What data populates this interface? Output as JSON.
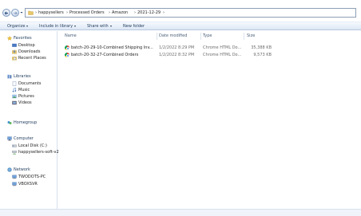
{
  "address": {
    "crumbs": [
      "happysellers",
      "Processed Orders",
      "Amazon",
      "2021-12-29"
    ]
  },
  "toolbar": {
    "organize": "Organize",
    "include_in_library": "Include in library",
    "share_with": "Share with",
    "new_folder": "New folder"
  },
  "navpane": {
    "favorites": {
      "title": "Favorites",
      "items": [
        "Desktop",
        "Downloads",
        "Recent Places"
      ]
    },
    "libraries": {
      "title": "Libraries",
      "items": [
        "Documents",
        "Music",
        "Pictures",
        "Videos"
      ]
    },
    "homegroup": "Homegroup",
    "computer": {
      "title": "Computer",
      "items": [
        "Local Disk (C:)",
        "happysellers-soft-v2"
      ]
    },
    "network": {
      "title": "Network",
      "items": [
        "TWODOTS-PC",
        "VBOXSVR"
      ]
    }
  },
  "columns": {
    "name": "Name",
    "date_modified": "Date modified",
    "type": "Type",
    "size": "Size"
  },
  "files": [
    {
      "name": "batch-20-29-10-Combined Shipping Inv...",
      "date": "1/2/2022 8:29 PM",
      "type": "Chrome HTML Do...",
      "size": "35,388 KB"
    },
    {
      "name": "batch-20-32-27-Combined Orders",
      "date": "1/2/2022 8:32 PM",
      "type": "Chrome HTML Do...",
      "size": "9,573 KB"
    }
  ],
  "icons": {
    "back": "back-arrow-icon",
    "forward": "forward-arrow-icon",
    "folder": "folder-icon",
    "chrome": "chrome-icon",
    "star": "star-icon",
    "library": "library-icon",
    "homegroup": "homegroup-icon",
    "computer": "computer-icon",
    "network": "network-icon"
  },
  "colors": {
    "toolbar_text": "#1e395b",
    "window_bg": "#ffffff"
  }
}
